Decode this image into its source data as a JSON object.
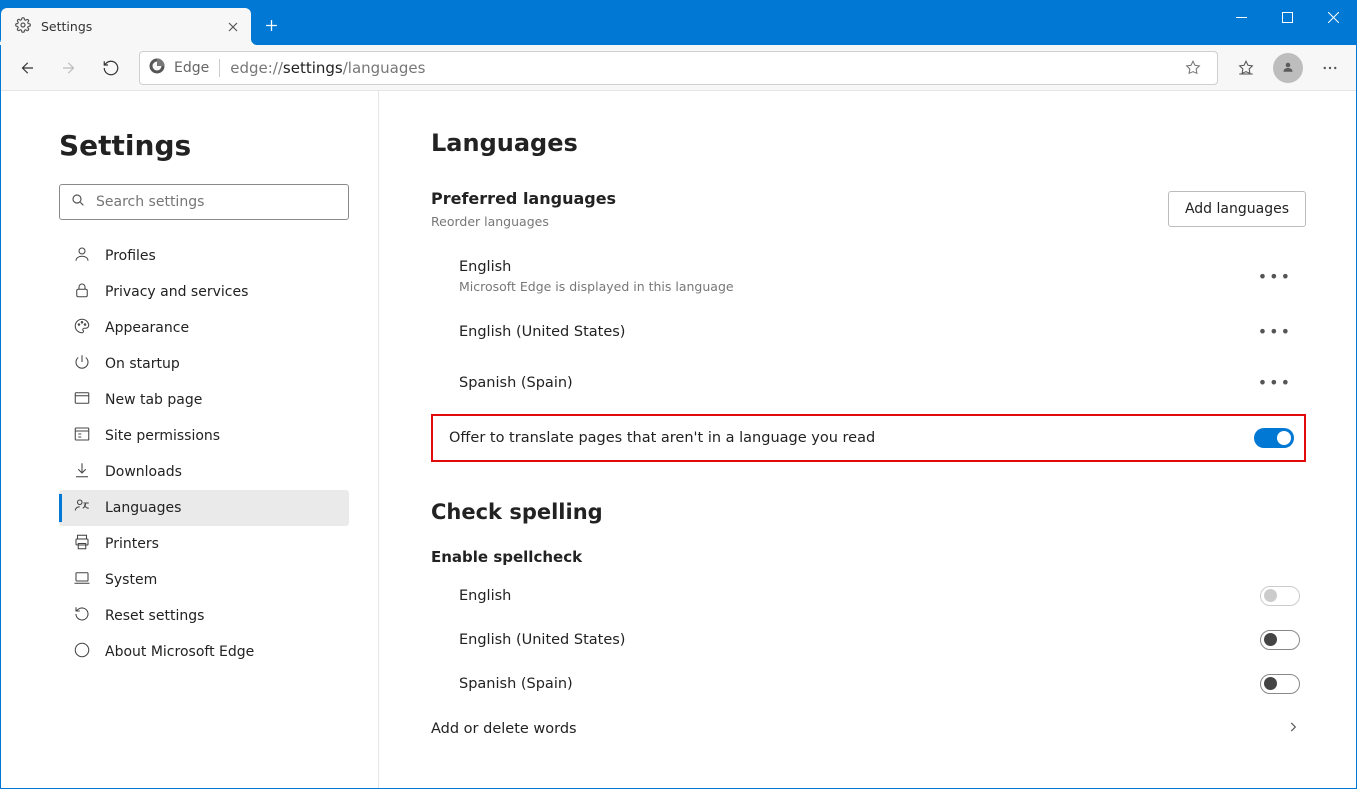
{
  "window": {
    "tab_title": "Settings"
  },
  "address_bar": {
    "identity_label": "Edge",
    "url_prefix": "edge://",
    "url_strong": "settings",
    "url_suffix": "/languages"
  },
  "sidebar": {
    "title": "Settings",
    "search_placeholder": "Search settings",
    "items": [
      {
        "label": "Profiles",
        "icon": "person-icon"
      },
      {
        "label": "Privacy and services",
        "icon": "lock-icon"
      },
      {
        "label": "Appearance",
        "icon": "palette-icon"
      },
      {
        "label": "On startup",
        "icon": "power-icon"
      },
      {
        "label": "New tab page",
        "icon": "window-icon"
      },
      {
        "label": "Site permissions",
        "icon": "permissions-icon"
      },
      {
        "label": "Downloads",
        "icon": "download-icon"
      },
      {
        "label": "Languages",
        "icon": "language-icon",
        "selected": true
      },
      {
        "label": "Printers",
        "icon": "printer-icon"
      },
      {
        "label": "System",
        "icon": "laptop-icon"
      },
      {
        "label": "Reset settings",
        "icon": "reset-icon"
      },
      {
        "label": "About Microsoft Edge",
        "icon": "edge-icon"
      }
    ]
  },
  "main": {
    "languages_heading": "Languages",
    "preferred_heading": "Preferred languages",
    "preferred_caption": "Reorder languages",
    "add_button": "Add languages",
    "preferred_list": [
      {
        "name": "English",
        "sub": "Microsoft Edge is displayed in this language"
      },
      {
        "name": "English (United States)"
      },
      {
        "name": "Spanish (Spain)"
      }
    ],
    "translate_label": "Offer to translate pages that aren't in a language you read",
    "spelling_heading": "Check spelling",
    "spellcheck_label": "Enable spellcheck",
    "spellcheck_list": [
      {
        "name": "English",
        "on": false,
        "disabled": true
      },
      {
        "name": "English (United States)",
        "on": false
      },
      {
        "name": "Spanish (Spain)",
        "on": false
      }
    ],
    "add_words_label": "Add or delete words"
  }
}
